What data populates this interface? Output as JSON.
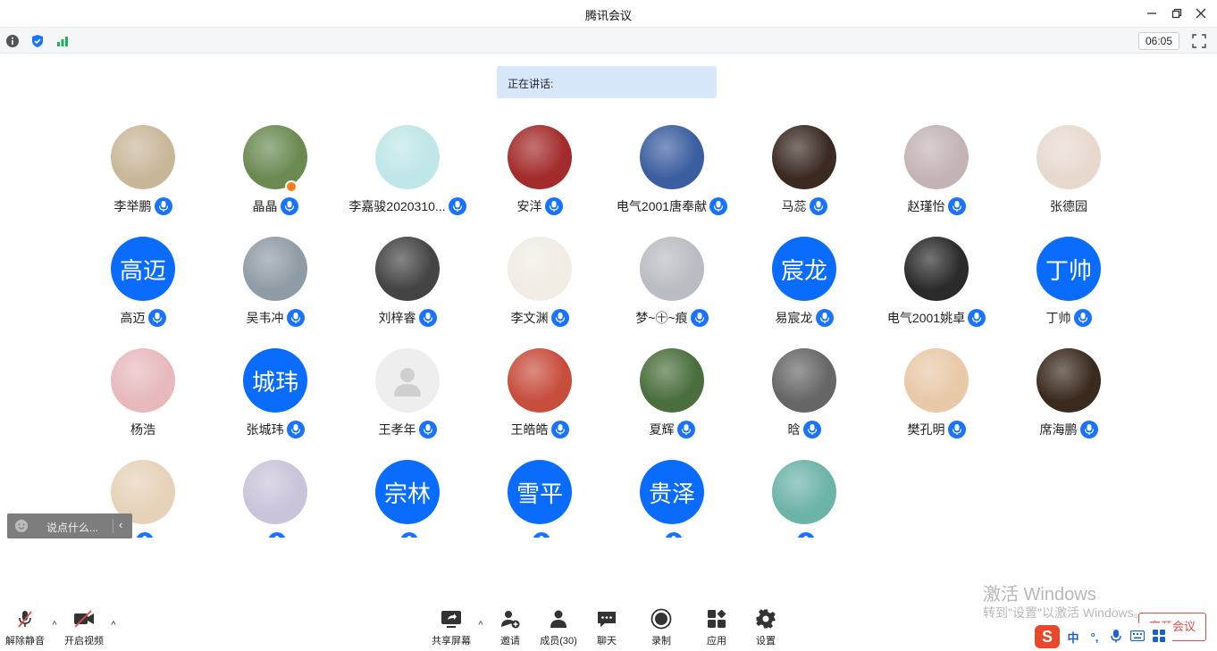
{
  "window": {
    "title": "腾讯会议"
  },
  "top_toolbar": {
    "timer": "06:05"
  },
  "speaking": {
    "label": "正在讲话:"
  },
  "participants": [
    {
      "name": "李举鹏",
      "avatar_text": "",
      "avatar_color": "#c9b79a",
      "mic": true
    },
    {
      "name": "晶晶",
      "avatar_text": "",
      "avatar_color": "#6b8a52",
      "mic": true,
      "host": true
    },
    {
      "name": "李嘉骏2020310...",
      "avatar_text": "",
      "avatar_color": "#bfe6e8",
      "mic": true
    },
    {
      "name": "安洋",
      "avatar_text": "",
      "avatar_color": "#a32b2b",
      "mic": true
    },
    {
      "name": "电气2001唐奉献",
      "avatar_text": "",
      "avatar_color": "#3b5ea0",
      "mic": true
    },
    {
      "name": "马蕊",
      "avatar_text": "",
      "avatar_color": "#3a2a22",
      "mic": true
    },
    {
      "name": "赵瑾怡",
      "avatar_text": "",
      "avatar_color": "#c4b4b6",
      "mic": true
    },
    {
      "name": "张德园",
      "avatar_text": "",
      "avatar_color": "#e8d9cf",
      "mic": false
    },
    {
      "name": "高迈",
      "avatar_text": "高迈",
      "avatar_color": "#0a6cff",
      "mic": true
    },
    {
      "name": "吴韦冲",
      "avatar_text": "",
      "avatar_color": "#8f9ba5",
      "mic": true
    },
    {
      "name": "刘梓睿",
      "avatar_text": "",
      "avatar_color": "#444444",
      "mic": true
    },
    {
      "name": "李文渊",
      "avatar_text": "",
      "avatar_color": "#f1ece4",
      "mic": true
    },
    {
      "name": "梦~㊉~痕",
      "avatar_text": "",
      "avatar_color": "#b9bcc2",
      "mic": true
    },
    {
      "name": "易宸龙",
      "avatar_text": "宸龙",
      "avatar_color": "#0a6cff",
      "mic": true
    },
    {
      "name": "电气2001姚卓",
      "avatar_text": "",
      "avatar_color": "#2a2a2a",
      "mic": true
    },
    {
      "name": "丁帅",
      "avatar_text": "丁帅",
      "avatar_color": "#0a6cff",
      "mic": true
    },
    {
      "name": "杨浩",
      "avatar_text": "",
      "avatar_color": "#e7b9bd",
      "mic": false
    },
    {
      "name": "张城玮",
      "avatar_text": "城玮",
      "avatar_color": "#0a6cff",
      "mic": true
    },
    {
      "name": "王孝年",
      "avatar_text": "",
      "avatar_color": "#eeeeee",
      "mic": true,
      "placeholder": true
    },
    {
      "name": "王皓皓",
      "avatar_text": "",
      "avatar_color": "#c74d3d",
      "mic": true
    },
    {
      "name": "夏辉",
      "avatar_text": "",
      "avatar_color": "#4a6e3d",
      "mic": true
    },
    {
      "name": "晗",
      "avatar_text": "",
      "avatar_color": "#666666",
      "mic": true
    },
    {
      "name": "樊孔明",
      "avatar_text": "",
      "avatar_color": "#e8c9a8",
      "mic": true
    },
    {
      "name": "席海鹏",
      "avatar_text": "",
      "avatar_color": "#3a2a1e",
      "mic": true
    },
    {
      "name": "",
      "avatar_text": "",
      "avatar_color": "#e6d2b8",
      "mic": true
    },
    {
      "name": "",
      "avatar_text": "",
      "avatar_color": "#c9c4d9",
      "mic": true
    },
    {
      "name": "",
      "avatar_text": "宗林",
      "avatar_color": "#0a6cff",
      "mic": true
    },
    {
      "name": "",
      "avatar_text": "雪平",
      "avatar_color": "#0a6cff",
      "mic": true
    },
    {
      "name": "",
      "avatar_text": "贵泽",
      "avatar_color": "#0a6cff",
      "mic": true
    },
    {
      "name": "",
      "avatar_text": "",
      "avatar_color": "#6cb3a8",
      "mic": true
    }
  ],
  "chat": {
    "placeholder": "说点什么..."
  },
  "bottom_toolbar": {
    "unmute": "解除静音",
    "video": "开启视频",
    "share": "共享屏幕",
    "invite": "邀请",
    "members": "成员(30)",
    "chat": "聊天",
    "record": "录制",
    "apps": "应用",
    "settings": "设置",
    "leave": "离开会议"
  },
  "watermark": {
    "line1": "激活 Windows",
    "line2": "转到\"设置\"以激活 Windows。"
  },
  "ime": {
    "lang": "中"
  }
}
